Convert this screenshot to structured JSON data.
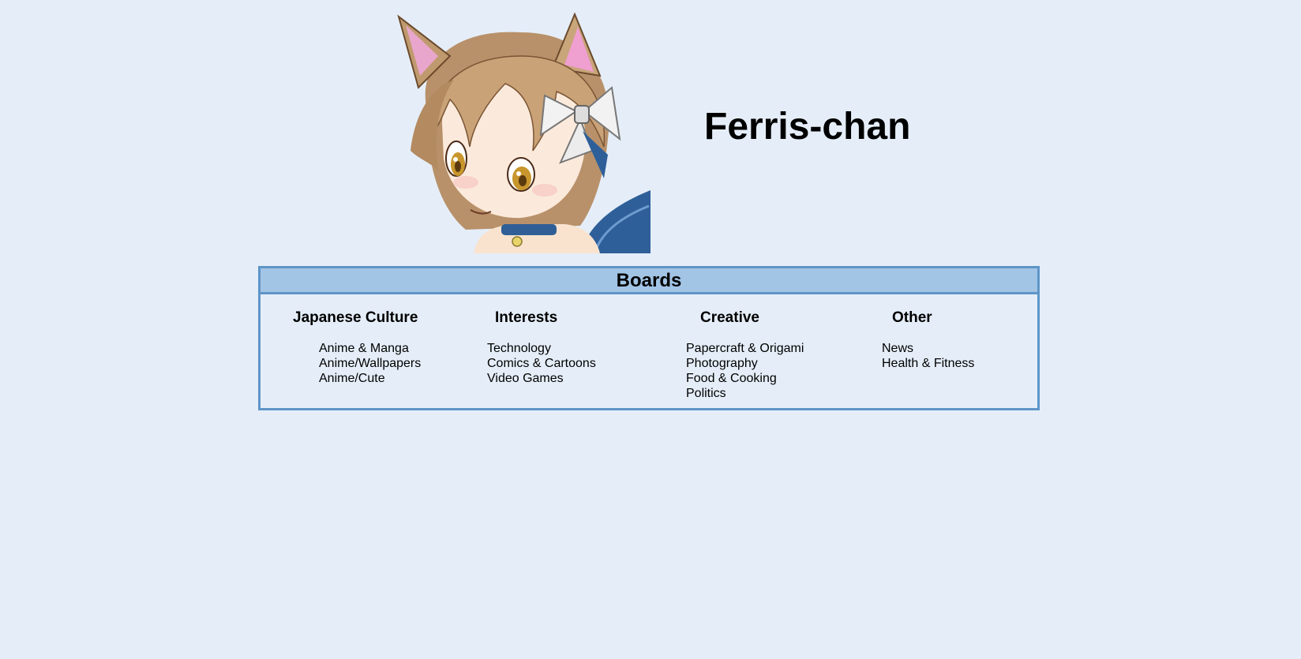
{
  "site": {
    "title": "Ferris-chan"
  },
  "mascot": {
    "icon": "cat-girl-mascot"
  },
  "boards": {
    "title": "Boards",
    "categories": [
      {
        "name": "Japanese Culture",
        "items": [
          "Anime & Manga",
          "Anime/Wallpapers",
          "Anime/Cute"
        ]
      },
      {
        "name": "Interests",
        "items": [
          "Technology",
          "Comics & Cartoons",
          "Video Games"
        ]
      },
      {
        "name": "Creative",
        "items": [
          "Papercraft & Origami",
          "Photography",
          "Food & Cooking",
          "Politics"
        ]
      },
      {
        "name": "Other",
        "items": [
          "News",
          "Health & Fitness"
        ]
      }
    ]
  },
  "colors": {
    "background": "#e5eef8",
    "header_fill": "#a2c4e5",
    "border": "#5e95c8"
  }
}
